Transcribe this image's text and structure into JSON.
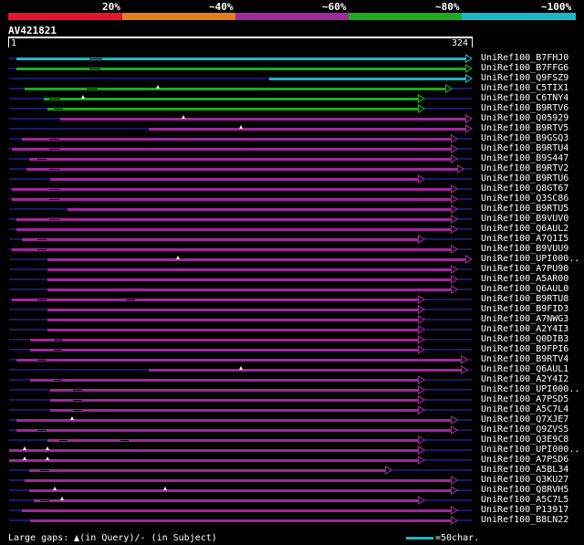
{
  "colors": {
    "background": "#000000",
    "bin_20": "#e8142c",
    "bin_40": "#e87c1c",
    "bin_60": "#a0289c",
    "bin_80": "#1cac1c",
    "bin_100": "#18b8c8",
    "track": "#1a1a66",
    "gap_marker": "#ffffcc"
  },
  "identity_scale": {
    "labels": [
      "20%",
      "~40%",
      "~60%",
      "~80%",
      "~100%"
    ],
    "bins": [
      "bin_20",
      "bin_40",
      "bin_60",
      "bin_80",
      "bin_100"
    ]
  },
  "query": {
    "name": "AV421821",
    "start": "1",
    "end": "324",
    "length": 324
  },
  "hits": [
    {
      "name": "UniRef100_B7FHJ0",
      "color": "bin_100",
      "start": 5,
      "end": 324,
      "gq": [],
      "gs": [
        [
          56,
          65
        ]
      ]
    },
    {
      "name": "UniRef100_B7FFG6",
      "color": "bin_80",
      "start": 5,
      "end": 324,
      "gq": [],
      "gs": [
        [
          56,
          64
        ]
      ]
    },
    {
      "name": "UniRef100_Q9FSZ9",
      "color": "bin_100",
      "start": 182,
      "end": 324,
      "gq": [],
      "gs": []
    },
    {
      "name": "UniRef100_C5TIX1",
      "color": "bin_80",
      "start": 11,
      "end": 310,
      "gq": [
        104
      ],
      "gs": [
        [
          54,
          62
        ]
      ]
    },
    {
      "name": "UniRef100_C6TNY4",
      "color": "bin_80",
      "start": 24,
      "end": 291,
      "gq": [
        52
      ],
      "gs": [
        [
          28,
          36
        ]
      ]
    },
    {
      "name": "UniRef100_B9RTV6",
      "color": "bin_80",
      "start": 27,
      "end": 291,
      "gq": [],
      "gs": [
        [
          31,
          38
        ]
      ]
    },
    {
      "name": "UniRef100_Q05929",
      "color": "bin_60",
      "start": 36,
      "end": 324,
      "gq": [
        122
      ],
      "gs": []
    },
    {
      "name": "UniRef100_B9RTV5",
      "color": "bin_60",
      "start": 98,
      "end": 324,
      "gq": [
        162
      ],
      "gs": []
    },
    {
      "name": "UniRef100_B9GSQ3",
      "color": "bin_60",
      "start": 9,
      "end": 314,
      "gq": [],
      "gs": [
        [
          28,
          35
        ]
      ]
    },
    {
      "name": "UniRef100_B9RTU4",
      "color": "bin_60",
      "start": 2,
      "end": 314,
      "gq": [],
      "gs": [
        [
          28,
          35
        ]
      ]
    },
    {
      "name": "UniRef100_B9S447",
      "color": "bin_60",
      "start": 14,
      "end": 314,
      "gq": [],
      "gs": [
        [
          20,
          26
        ]
      ]
    },
    {
      "name": "UniRef100_B9RTV2",
      "color": "bin_60",
      "start": 12,
      "end": 318,
      "gq": [],
      "gs": [
        [
          28,
          35
        ]
      ]
    },
    {
      "name": "UniRef100_B9RTU6",
      "color": "bin_60",
      "start": 29,
      "end": 291,
      "gq": [],
      "gs": []
    },
    {
      "name": "UniRef100_Q8GT67",
      "color": "bin_60",
      "start": 2,
      "end": 314,
      "gq": [],
      "gs": [
        [
          28,
          35
        ]
      ]
    },
    {
      "name": "UniRef100_Q3SC86",
      "color": "bin_60",
      "start": 2,
      "end": 314,
      "gq": [],
      "gs": [
        [
          28,
          35
        ]
      ]
    },
    {
      "name": "UniRef100_B9RTU5",
      "color": "bin_60",
      "start": 41,
      "end": 314,
      "gq": [],
      "gs": []
    },
    {
      "name": "UniRef100_B9VUV0",
      "color": "bin_60",
      "start": 5,
      "end": 314,
      "gq": [],
      "gs": [
        [
          28,
          35
        ]
      ]
    },
    {
      "name": "UniRef100_Q6AUL2",
      "color": "bin_60",
      "start": 5,
      "end": 314,
      "gq": [],
      "gs": []
    },
    {
      "name": "UniRef100_A7Q1I5",
      "color": "bin_60",
      "start": 9,
      "end": 291,
      "gq": [],
      "gs": [
        [
          20,
          26
        ]
      ]
    },
    {
      "name": "UniRef100_B9VUU9",
      "color": "bin_60",
      "start": 2,
      "end": 314,
      "gq": [],
      "gs": [
        [
          20,
          26
        ]
      ]
    },
    {
      "name": "UniRef100_UPI000..",
      "color": "bin_60",
      "start": 27,
      "end": 324,
      "gq": [
        118
      ],
      "gs": []
    },
    {
      "name": "UniRef100_A7PU90",
      "color": "bin_60",
      "start": 27,
      "end": 314,
      "gq": [],
      "gs": []
    },
    {
      "name": "UniRef100_A5AR00",
      "color": "bin_60",
      "start": 27,
      "end": 314,
      "gq": [],
      "gs": []
    },
    {
      "name": "UniRef100_Q6AUL0",
      "color": "bin_60",
      "start": 27,
      "end": 314,
      "gq": [],
      "gs": []
    },
    {
      "name": "UniRef100_B9RTU8",
      "color": "bin_60",
      "start": 2,
      "end": 291,
      "gq": [],
      "gs": [
        [
          20,
          26
        ],
        [
          82,
          88
        ]
      ]
    },
    {
      "name": "UniRef100_B9FID3",
      "color": "bin_60",
      "start": 27,
      "end": 291,
      "gq": [],
      "gs": []
    },
    {
      "name": "UniRef100_A7NWG3",
      "color": "bin_60",
      "start": 27,
      "end": 291,
      "gq": [],
      "gs": []
    },
    {
      "name": "UniRef100_A2Y4I3",
      "color": "bin_60",
      "start": 27,
      "end": 291,
      "gq": [],
      "gs": []
    },
    {
      "name": "UniRef100_Q0DIB3",
      "color": "bin_60",
      "start": 15,
      "end": 291,
      "gq": [],
      "gs": [
        [
          31,
          37
        ]
      ]
    },
    {
      "name": "UniRef100_B9FPI6",
      "color": "bin_60",
      "start": 15,
      "end": 291,
      "gq": [],
      "gs": [
        [
          31,
          37
        ]
      ]
    },
    {
      "name": "UniRef100_B9RTV4",
      "color": "bin_60",
      "start": 5,
      "end": 321,
      "gq": [],
      "gs": [
        [
          20,
          26
        ]
      ]
    },
    {
      "name": "UniRef100_Q6AUL1",
      "color": "bin_60",
      "start": 98,
      "end": 321,
      "gq": [
        162
      ],
      "gs": []
    },
    {
      "name": "UniRef100_A2Y4I2",
      "color": "bin_60",
      "start": 15,
      "end": 291,
      "gq": [],
      "gs": [
        [
          31,
          37
        ]
      ]
    },
    {
      "name": "UniRef100_UPI000..",
      "color": "bin_60",
      "start": 29,
      "end": 291,
      "gq": [],
      "gs": [
        [
          45,
          51
        ]
      ]
    },
    {
      "name": "UniRef100_A7PSD5",
      "color": "bin_60",
      "start": 29,
      "end": 291,
      "gq": [],
      "gs": [
        [
          45,
          51
        ]
      ]
    },
    {
      "name": "UniRef100_A5C7L4",
      "color": "bin_60",
      "start": 29,
      "end": 291,
      "gq": [],
      "gs": [
        [
          45,
          51
        ]
      ]
    },
    {
      "name": "UniRef100_Q7XJE7",
      "color": "bin_60",
      "start": 5,
      "end": 314,
      "gq": [
        44
      ],
      "gs": []
    },
    {
      "name": "UniRef100_Q9ZVS5",
      "color": "bin_60",
      "start": 5,
      "end": 314,
      "gq": [],
      "gs": [
        [
          20,
          26
        ]
      ]
    },
    {
      "name": "UniRef100_Q3E9C8",
      "color": "bin_60",
      "start": 27,
      "end": 291,
      "gq": [],
      "gs": [
        [
          35,
          41
        ],
        [
          78,
          84
        ]
      ]
    },
    {
      "name": "UniRef100_UPI000..",
      "color": "bin_60",
      "start": 0,
      "end": 291,
      "gq": [
        11,
        27
      ],
      "gs": []
    },
    {
      "name": "UniRef100_A7PSD6",
      "color": "bin_60",
      "start": 0,
      "end": 291,
      "gq": [
        11,
        27
      ],
      "gs": []
    },
    {
      "name": "UniRef100_A5BL34",
      "color": "bin_60",
      "start": 14,
      "end": 268,
      "gq": [],
      "gs": [
        [
          22,
          28
        ]
      ]
    },
    {
      "name": "UniRef100_Q3KU27",
      "color": "bin_60",
      "start": 11,
      "end": 314,
      "gq": [],
      "gs": []
    },
    {
      "name": "UniRef100_Q8RVH5",
      "color": "bin_60",
      "start": 14,
      "end": 314,
      "gq": [
        32,
        109
      ],
      "gs": []
    },
    {
      "name": "UniRef100_A5C7L5",
      "color": "bin_60",
      "start": 17,
      "end": 291,
      "gq": [
        37
      ],
      "gs": [
        [
          22,
          28
        ]
      ]
    },
    {
      "name": "UniRef100_P13917",
      "color": "bin_60",
      "start": 9,
      "end": 314,
      "gq": [],
      "gs": []
    },
    {
      "name": "UniRef100_B8LN22",
      "color": "bin_60",
      "start": 15,
      "end": 314,
      "gq": [],
      "gs": []
    }
  ],
  "legend": {
    "gaps_prefix": "Large gaps:",
    "gaps_query": "(in Query)/-",
    "gaps_subject": "(in Subject)",
    "scale_text": "=50char."
  }
}
